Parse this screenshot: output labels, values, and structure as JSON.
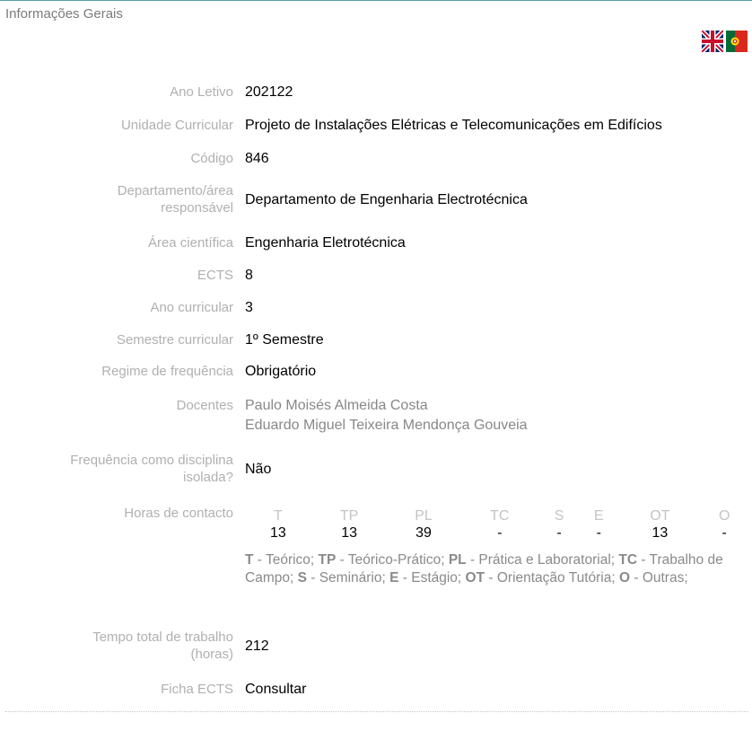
{
  "section_title": "Informações Gerais",
  "fields": {
    "ano_letivo": {
      "label": "Ano Letivo",
      "value": "202122"
    },
    "unidade_curricular": {
      "label": "Unidade Curricular",
      "value": "Projeto de Instalações Elétricas e Telecomunicações em Edifícios"
    },
    "codigo": {
      "label": "Código",
      "value": "846"
    },
    "departamento": {
      "label_1": "Departamento/área",
      "label_2": "responsável",
      "value": "Departamento de Engenharia Electrotécnica"
    },
    "area_cientifica": {
      "label": "Área científica",
      "value": "Engenharia Eletrotécnica"
    },
    "ects": {
      "label": "ECTS",
      "value": "8"
    },
    "ano_curricular": {
      "label": "Ano curricular",
      "value": "3"
    },
    "semestre": {
      "label": "Semestre curricular",
      "value": "1º Semestre"
    },
    "regime": {
      "label": "Regime de frequência",
      "value": "Obrigatório"
    },
    "docentes": {
      "label": "Docentes",
      "values": [
        "Paulo Moisés Almeida Costa",
        "Eduardo Miguel Teixeira Mendonça Gouveia"
      ]
    },
    "isolada": {
      "label_1": "Frequência como disciplina",
      "label_2": "isolada?",
      "value": "Não"
    },
    "horas": {
      "label": "Horas de contacto",
      "headers": [
        "T",
        "TP",
        "PL",
        "TC",
        "S",
        "E",
        "OT",
        "O"
      ],
      "values": [
        "13",
        "13",
        "39",
        "-",
        "-",
        "-",
        "13",
        "-"
      ],
      "legend": [
        {
          "abbr": "T",
          "text": " - Teórico; "
        },
        {
          "abbr": "TP",
          "text": " - Teórico-Prático; "
        },
        {
          "abbr": "PL",
          "text": " - Prática e Laboratorial; "
        },
        {
          "abbr": "TC",
          "text": " - Trabalho de Campo; "
        },
        {
          "abbr": "S",
          "text": " - Seminário; "
        },
        {
          "abbr": "E",
          "text": " - Estágio; "
        },
        {
          "abbr": "OT",
          "text": " - Orientação Tutória; "
        },
        {
          "abbr": "O",
          "text": " - Outras;"
        }
      ]
    },
    "tempo_total": {
      "label_1": "Tempo total de trabalho",
      "label_2": "(horas)",
      "value": "212"
    },
    "ficha_ects": {
      "label": "Ficha ECTS",
      "value": "Consultar"
    }
  },
  "language_flags": [
    {
      "icon": "uk-flag-icon"
    },
    {
      "icon": "portugal-flag-icon"
    }
  ]
}
